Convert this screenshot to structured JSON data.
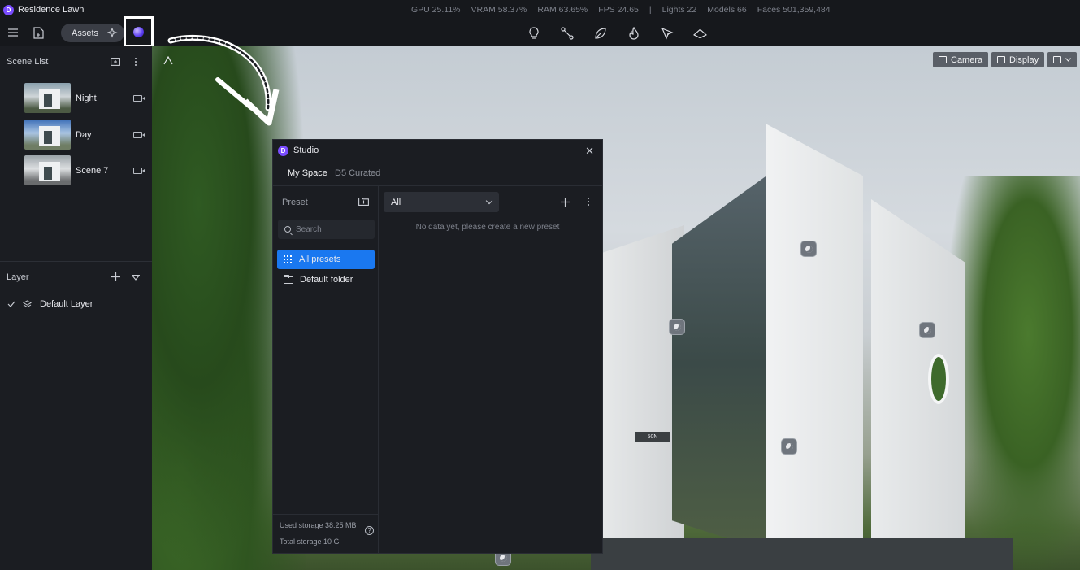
{
  "app": {
    "title": "Residence Lawn",
    "logo_letter": "D"
  },
  "stats": {
    "gpu": "GPU 25.11%",
    "vram": "VRAM 58.37%",
    "ram": "RAM 63.65%",
    "fps": "FPS 24.65",
    "separator": "|",
    "lights": "Lights 22",
    "models": "Models 66",
    "faces": "Faces 501,359,484"
  },
  "toolbar": {
    "assets_label": "Assets",
    "center_tools": [
      "light-bulb-icon",
      "path-icon",
      "leaf-icon",
      "flame-icon",
      "pen-tool-icon",
      "terrain-icon"
    ]
  },
  "scene_list": {
    "title": "Scene List",
    "items": [
      {
        "label": "Night",
        "thumb": "night"
      },
      {
        "label": "Day",
        "thumb": "day"
      },
      {
        "label": "Scene 7",
        "thumb": "scene7"
      }
    ]
  },
  "layer": {
    "title": "Layer",
    "items": [
      {
        "label": "Default Layer",
        "checked": true
      }
    ]
  },
  "viewport": {
    "camera_label": "Camera",
    "display_label": "Display",
    "sign_text": "50N"
  },
  "studio": {
    "title": "Studio",
    "logo_letter": "D",
    "tabs": [
      {
        "label": "My Space",
        "active": true
      },
      {
        "label": "D5 Curated",
        "active": false
      }
    ],
    "preset_label": "Preset",
    "search_placeholder": "Search",
    "nav": [
      {
        "label": "All presets",
        "active": true
      },
      {
        "label": "Default folder",
        "active": false
      }
    ],
    "filter_value": "All",
    "empty_message": "No data yet, please create a new preset",
    "used_storage": "Used storage 38.25 MB",
    "total_storage": "Total storage 10 G"
  },
  "colors": {
    "accent": "#1a78f0",
    "brand": "#7a4cff",
    "panel_bg": "#1b1d22",
    "topbar_bg": "#16181c"
  }
}
